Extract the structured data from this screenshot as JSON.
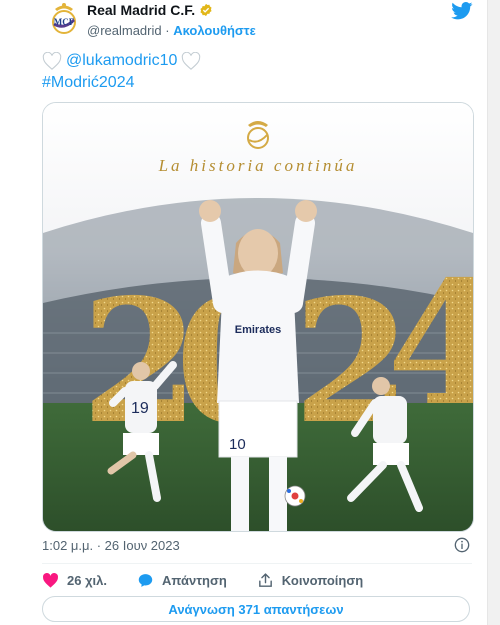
{
  "header": {
    "author_name": "Real Madrid C.F.",
    "handle": "@realmadrid",
    "separator": "·",
    "follow_label": "Ακολουθήστε"
  },
  "tweet": {
    "mention": "@lukamodric10",
    "hashtag": "#Modrić2024"
  },
  "media": {
    "headline": "La historia continúa",
    "year_digits": [
      "2",
      "0",
      "2",
      "4"
    ],
    "jersey_number": "10",
    "sponsor": "Emirates"
  },
  "meta": {
    "timestamp": "1:02 μ.μ. · 26 Ιουν 2023"
  },
  "actions": {
    "like_count": "26 χιλ.",
    "reply_label": "Απάντηση",
    "share_label": "Κοινοποίηση"
  },
  "read_replies_label": "Ανάγνωση 371 απαντήσεων",
  "colors": {
    "twitter_blue": "#1d9bf0",
    "like_pink": "#f91880",
    "gold": "#c9a24a",
    "text_secondary": "#536471"
  }
}
